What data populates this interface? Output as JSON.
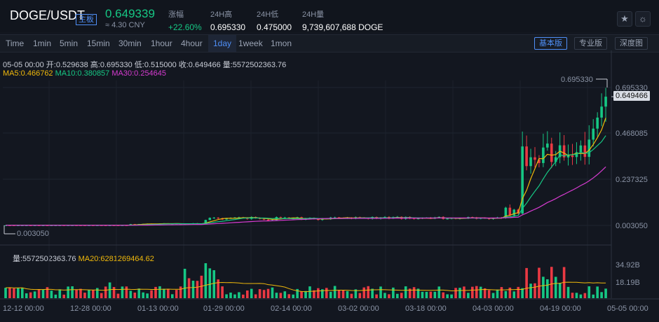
{
  "header": {
    "pair": "DOGE/USDT",
    "market_tag": "主板",
    "price": "0.649339",
    "cny": "≈ 4.30 CNY",
    "change_label": "涨幅",
    "change_value": "+22.60%",
    "high_label": "24H高",
    "high_value": "0.695330",
    "low_label": "24H低",
    "low_value": "0.475000",
    "vol_label": "24H量",
    "vol_value": "9,739,607,688 DOGE",
    "star_icon": "star-icon",
    "theme_icon": "sun-icon"
  },
  "toolbar": {
    "timeframes": [
      "Time",
      "1min",
      "5min",
      "15min",
      "30min",
      "1hour",
      "4hour",
      "1day",
      "1week",
      "1mon"
    ],
    "active_timeframe": "1day",
    "views": [
      "基本版",
      "专业版",
      "深度图"
    ],
    "active_view": "基本版"
  },
  "ohlc": {
    "line": "05-05 00:00   开:0.529638  高:0.695330  低:0.515000  收:0.649466  量:5572502363.76",
    "ma5": "MA5:0.466762",
    "ma10": "MA10:0.380857",
    "ma30": "MA30:0.254645"
  },
  "volume_info": {
    "vol": "量:5572502363.76",
    "ma20": "MA20:6281269464.62"
  },
  "chart_data": {
    "type": "candlestick",
    "price_axis": [
      "0.695330",
      "0.468085",
      "0.237325",
      "0.003050"
    ],
    "max_marker": "0.695330",
    "min_marker": "0.003050",
    "last_price_tag": "0.649466",
    "volume_axis": [
      "34.92B",
      "18.19B"
    ],
    "x_ticks": [
      "12-12 00:00",
      "12-28 00:00",
      "01-13 00:00",
      "01-29 00:00",
      "02-14 00:00",
      "03-02 00:00",
      "03-18 00:00",
      "04-03 00:00",
      "04-19 00:00",
      "05-05 00:00"
    ],
    "colors": {
      "up": "#16c784",
      "down": "#ea3943",
      "ma5": "#f0b90b",
      "ma10": "#16c784",
      "ma30": "#d63bd0",
      "vol_ma": "#f0b90b"
    }
  }
}
